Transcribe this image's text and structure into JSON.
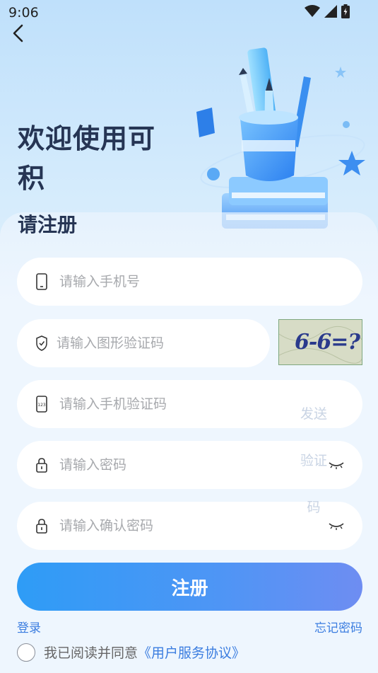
{
  "status_bar": {
    "time": "9:06",
    "icons": [
      "wifi-icon",
      "signal-icon",
      "battery-icon"
    ]
  },
  "nav": {
    "back_icon": "chevron-left-icon"
  },
  "header": {
    "welcome": "欢迎使用可积",
    "subtitle": "请注册"
  },
  "form": {
    "phone": {
      "placeholder": "请输入手机号",
      "icon": "phone-icon"
    },
    "captcha": {
      "placeholder": "请输入图形验证码",
      "icon": "shield-icon",
      "image_text": "6-6=?"
    },
    "sms": {
      "placeholder": "请输入手机验证码",
      "icon": "sms-icon",
      "send_label": "发送验证码"
    },
    "password": {
      "placeholder": "请输入密码",
      "icon": "lock-icon",
      "toggle_icon": "eye-closed-icon"
    },
    "confirm": {
      "placeholder": "请输入确认密码",
      "icon": "lock-icon",
      "toggle_icon": "eye-closed-icon"
    }
  },
  "actions": {
    "register_label": "注册",
    "login_label": "登录",
    "forgot_label": "忘记密码"
  },
  "agreement": {
    "text": "我已阅读并同意",
    "link": "《用户服务协议》"
  },
  "colors": {
    "accent": "#3b7de0",
    "button_start": "#2e9cf6",
    "button_end": "#6e8df2",
    "title": "#263554"
  }
}
